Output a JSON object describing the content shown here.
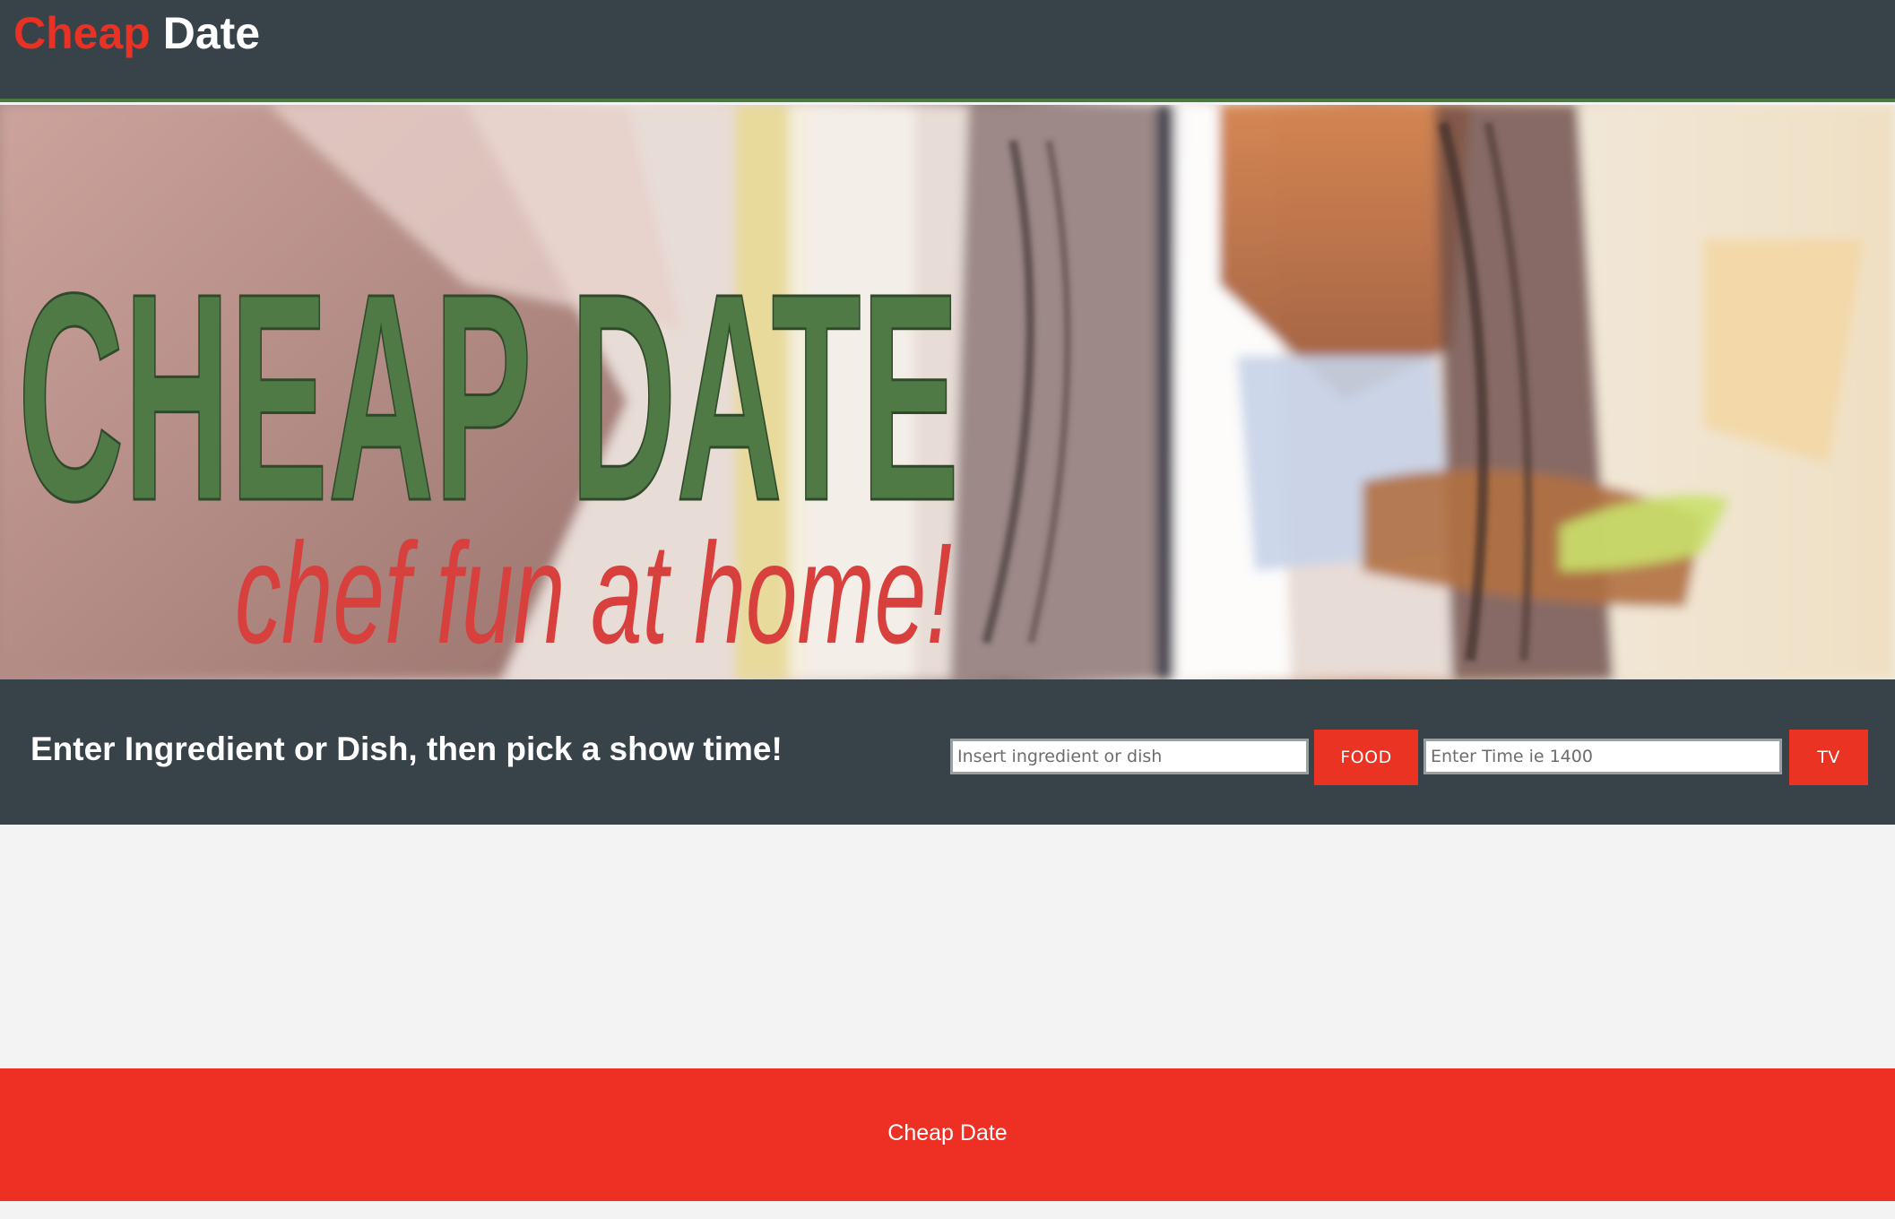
{
  "header": {
    "brand_part1": "Cheap",
    "brand_part2": "Date"
  },
  "hero": {
    "title": "CHEAP DATE",
    "tagline": "chef fun at home!"
  },
  "search": {
    "prompt": "Enter Ingredient or Dish, then pick a show time!",
    "food_placeholder": "Insert ingredient or dish",
    "food_button_label": "FOOD",
    "time_placeholder": "Enter Time ie 1400",
    "tv_button_label": "TV"
  },
  "footer": {
    "text": "Cheap Date"
  },
  "colors": {
    "header_bg": "#384249",
    "accent_red": "#ea3323",
    "hero_title_green": "#4f7a45",
    "hero_tagline_red": "#d7403d",
    "page_bg": "#f3f3f3"
  }
}
